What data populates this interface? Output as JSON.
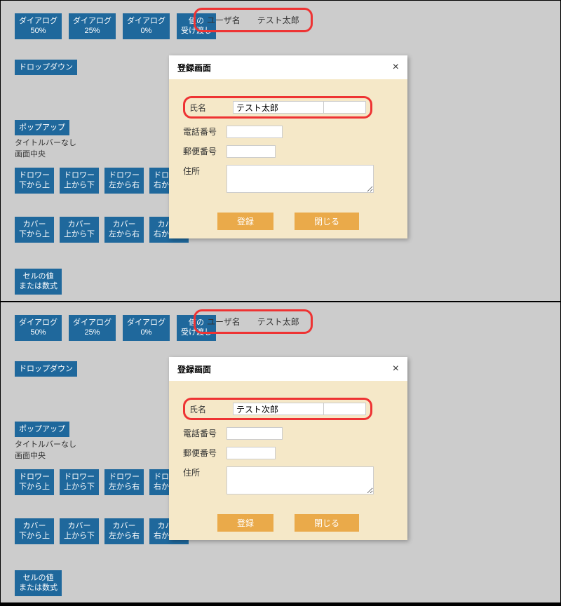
{
  "panels": [
    {
      "user_label": "ユーザ名",
      "user_value": "テスト太郎",
      "dialog": {
        "title": "登録画面",
        "name_label": "氏名",
        "name_value": "テスト太郎",
        "tel_label": "電話番号",
        "tel_value": "",
        "post_label": "郵便番号",
        "post_value": "",
        "addr_label": "住所",
        "addr_value": "",
        "btn_register": "登録",
        "btn_close": "閉じる"
      }
    },
    {
      "user_label": "ユーザ名",
      "user_value": "テスト太郎",
      "dialog": {
        "title": "登録画面",
        "name_label": "氏名",
        "name_value": "テスト次郎",
        "tel_label": "電話番号",
        "tel_value": "",
        "post_label": "郵便番号",
        "post_value": "",
        "addr_label": "住所",
        "addr_value": "",
        "btn_register": "登録",
        "btn_close": "閉じる"
      }
    }
  ],
  "buttons": {
    "dlg50": "ダイアログ\n50%",
    "dlg25": "ダイアログ\n25%",
    "dlg0": "ダイアログ\n0%",
    "valpass": "値の\n受け渡し",
    "dropdown": "ドロップダウン",
    "popup": "ポップアップ",
    "popup_note1": "タイトルバーなし",
    "popup_note2": "画面中央",
    "drawer_bu": "ドロワー\n下から上",
    "drawer_ud": "ドロワー\n上から下",
    "drawer_lr": "ドロワー\n左から右",
    "drawer_rl": "ドロワー\n右から左",
    "cover_bu": "カバー\n下から上",
    "cover_ud": "カバー\n上から下",
    "cover_lr": "カバー\n左から右",
    "cover_rl": "カバー\n右から左",
    "cell": "セルの値\nまたは数式"
  }
}
